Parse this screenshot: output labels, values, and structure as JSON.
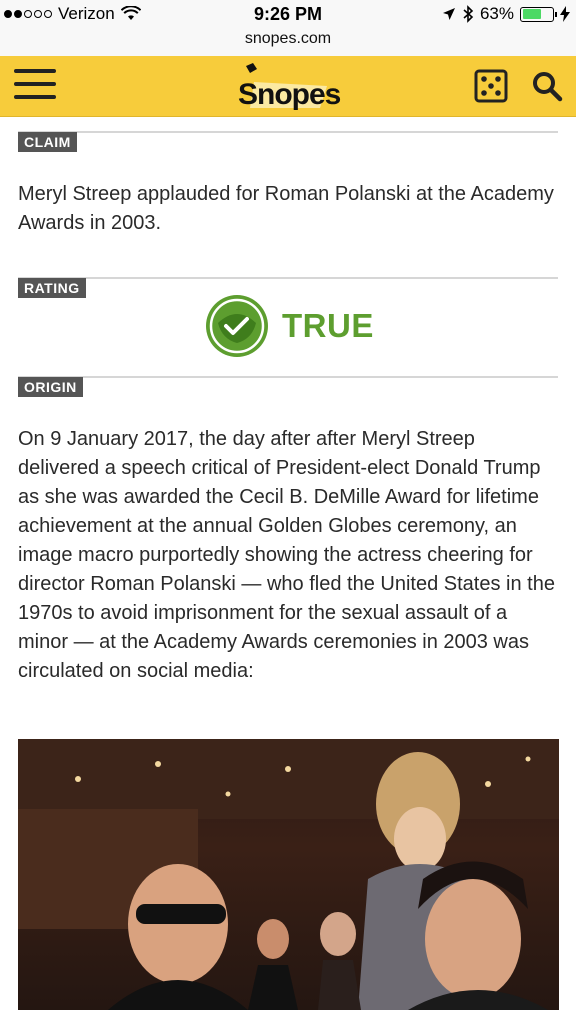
{
  "status_bar": {
    "carrier": "Verizon",
    "time": "9:26 PM",
    "battery": "63%",
    "battery_level": 0.63,
    "signal_bars": 2
  },
  "browser": {
    "url": "snopes.com"
  },
  "header": {
    "logo_text": "Snopes",
    "icons": [
      "menu-icon",
      "dice-icon",
      "search-icon"
    ]
  },
  "article": {
    "claim_tag": "CLAIM",
    "claim_text": "Meryl Streep applauded for Roman Polanski at the Academy Awards in 2003.",
    "rating_tag": "RATING",
    "rating_value": "TRUE",
    "rating_color": "#5d9e2f",
    "origin_tag": "ORIGIN",
    "origin_text": "On 9 January 2017, the day after after Meryl Streep delivered a speech critical of President-elect Donald Trump as she was awarded the Cecil B. DeMille Award for lifetime achievement at the annual Golden Globes ceremony, an image macro purportedly showing the actress cheering for director Roman Polanski — who fled the United States in the 1970s to avoid imprisonment for the sexual assault of a minor — at the Academy Awards ceremonies in 2003 was circulated on social media:"
  },
  "colors": {
    "header_bg": "#f7cc3b",
    "tag_bg": "#555555"
  }
}
